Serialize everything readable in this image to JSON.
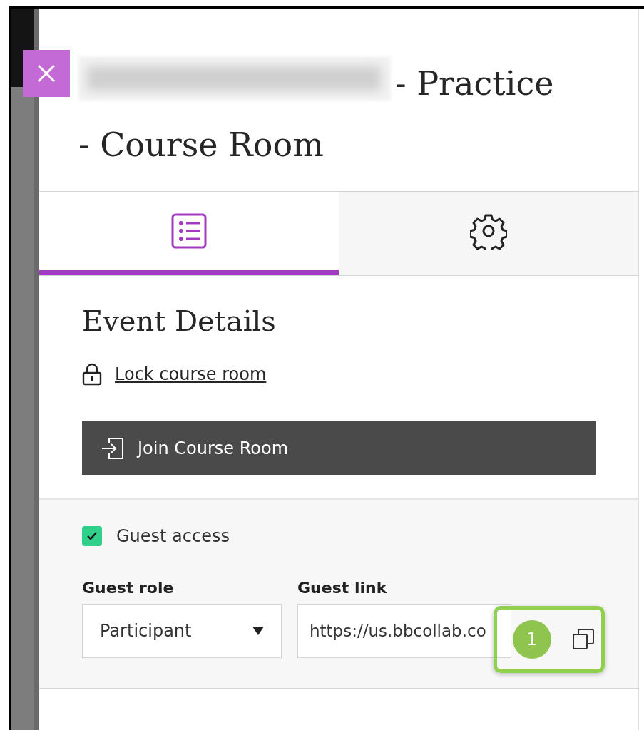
{
  "panel": {
    "title_name_blurred": true,
    "title": "- Practice - Course Room"
  },
  "tabs": [
    {
      "kind": "list",
      "selected": true
    },
    {
      "kind": "settings",
      "selected": false
    }
  ],
  "details": {
    "heading": "Event Details",
    "lock_link": "Lock course room",
    "join_button": "Join Course Room"
  },
  "guest": {
    "label": "Guest access",
    "checked": true,
    "role": {
      "label": "Guest role",
      "value": "Participant"
    },
    "link": {
      "label": "Guest link",
      "value": "https://us.bbcollab.co"
    }
  },
  "callout": {
    "number": "1"
  }
}
